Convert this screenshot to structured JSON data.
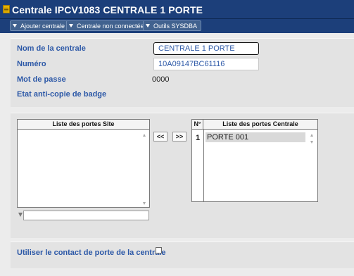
{
  "window": {
    "title": "Centrale IPCV1083 CENTRALE 1 PORTE"
  },
  "toolbar": {
    "add_label": "Ajouter centrale",
    "status_label": "Centrale non connectée",
    "tools_label": "Outils SYSDBA"
  },
  "form": {
    "name_label": "Nom de la centrale",
    "name_value": "CENTRALE 1 PORTE",
    "number_label": "Numéro",
    "number_value": "10A09147BC61116",
    "password_label": "Mot de passe",
    "password_value": "0000",
    "anticopy_label": "Etat anti-copie de badge"
  },
  "lists": {
    "site_header": "Liste des portes Site",
    "central_header": "Liste des portes Centrale",
    "number_header": "N°",
    "move_right_label": "<<",
    "move_left_label": ">>",
    "filter_value": "",
    "central_rows": [
      {
        "number": "1",
        "name": "PORTE 001"
      }
    ]
  },
  "footer": {
    "contact_label": "Utiliser le contact de porte de la centrale",
    "contact_checked": false
  },
  "colors": {
    "title_bar": "#1c3f7a",
    "label_blue": "#2c58a7"
  }
}
